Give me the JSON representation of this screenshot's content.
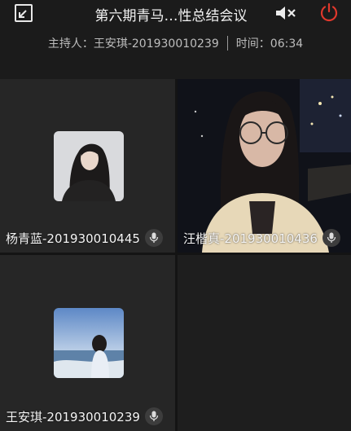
{
  "header": {
    "title": "第六期青马…性总结会议",
    "icons": {
      "exit_fullscreen": "collapse-icon",
      "speaker": "speaker-muted-icon",
      "power": "power-icon"
    },
    "power_color": "#e0382c"
  },
  "info": {
    "host_label": "主持人：王安琪-201930010239",
    "time_label": "时间：06:34"
  },
  "participants": [
    {
      "name": "杨青蓝-201930010445",
      "mic": "mic-icon",
      "type": "avatar"
    },
    {
      "name": "汪楷真-201930010436",
      "mic": "mic-icon",
      "type": "video"
    },
    {
      "name": "王安琪-201930010239",
      "mic": "mic-icon",
      "type": "avatar"
    }
  ]
}
